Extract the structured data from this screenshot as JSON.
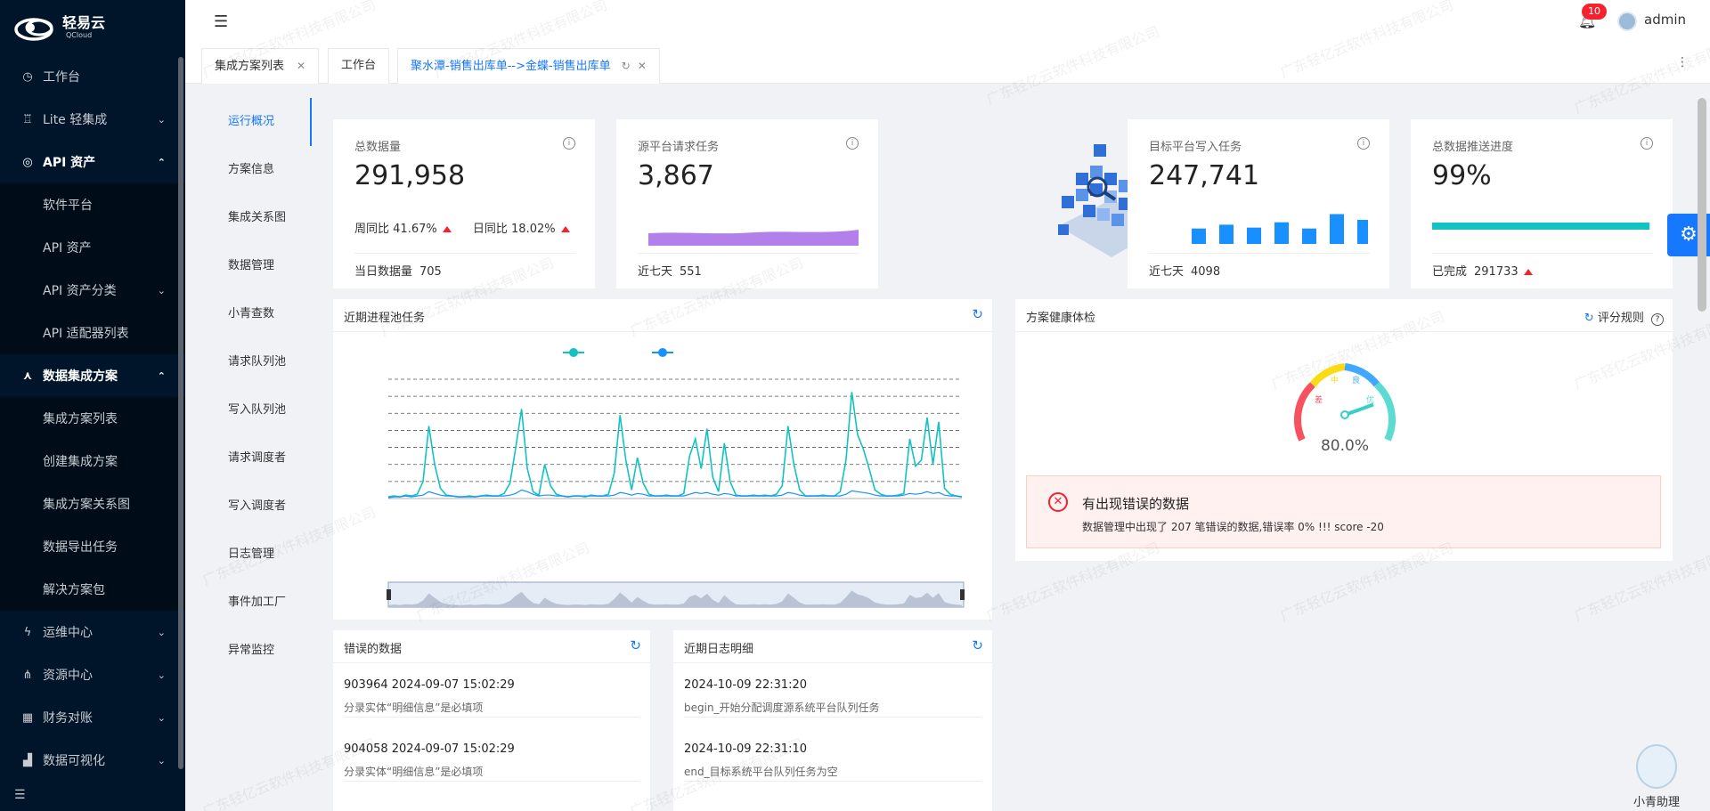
{
  "sidebar": {
    "logo_text": "轻易云",
    "logo_sub": "QCloud",
    "items": [
      {
        "label": "工作台",
        "icon": "clock-icon",
        "chevron": ""
      },
      {
        "label": "Lite 轻集成",
        "icon": "lite-icon",
        "chevron": "⌄"
      },
      {
        "label": "API 资产",
        "icon": "compass-icon",
        "chevron": "⌃"
      },
      {
        "label": "软件平台"
      },
      {
        "label": "API 资产"
      },
      {
        "label": "API 资产分类",
        "chevron": "⌄"
      },
      {
        "label": "API 适配器列表"
      },
      {
        "label": "数据集成方案",
        "icon": "cluster-icon",
        "chevron": "⌃"
      },
      {
        "label": "集成方案列表"
      },
      {
        "label": "创建集成方案"
      },
      {
        "label": "集成方案关系图"
      },
      {
        "label": "数据导出任务"
      },
      {
        "label": "解决方案包"
      },
      {
        "label": "运维中心",
        "icon": "bolt-icon",
        "chevron": "⌄"
      },
      {
        "label": "资源中心",
        "icon": "share-icon",
        "chevron": "⌄"
      },
      {
        "label": "财务对账",
        "icon": "calc-icon",
        "chevron": "⌄"
      },
      {
        "label": "数据可视化",
        "icon": "barchart-icon",
        "chevron": "⌄"
      }
    ]
  },
  "header": {
    "notification_count": "10",
    "username": "admin"
  },
  "tabs": [
    {
      "label": "集成方案列表"
    },
    {
      "label": "工作台"
    },
    {
      "label": "聚水潭-销售出库单-->金蝶-销售出库单"
    }
  ],
  "subnav": [
    "运行概况",
    "方案信息",
    "集成关系图",
    "数据管理",
    "小青查数",
    "请求队列池",
    "写入队列池",
    "请求调度者",
    "写入调度者",
    "日志管理",
    "事件加工厂",
    "异常监控"
  ],
  "stats": {
    "total": {
      "title": "总数据量",
      "value": "291,958",
      "wow_label": "周同比",
      "wow_value": "41.67%",
      "dod_label": "日同比",
      "dod_value": "18.02%",
      "foot_label": "当日数据量",
      "foot_value": "705"
    },
    "source": {
      "title": "源平台请求任务",
      "value": "3,867",
      "foot_label": "近七天",
      "foot_value": "551"
    },
    "target": {
      "title": "目标平台写入任务",
      "value": "247,741",
      "foot_label": "近七天",
      "foot_value": "4098",
      "bars": [
        0.32,
        0.4,
        0.34,
        0.45,
        0.32,
        0.62,
        0.5
      ]
    },
    "progress": {
      "title": "总数据推送进度",
      "value": "99%",
      "percent": 99,
      "foot_label": "已完成",
      "foot_value": "291733"
    }
  },
  "panels": {
    "recent_pool": {
      "title": "近期进程池任务"
    },
    "health": {
      "title": "方案健康体检",
      "rule_label": "评分规则",
      "score_text": "80.0%",
      "score": 80,
      "gauge_labels": {
        "poor": "差",
        "mid": "中",
        "good": "良",
        "excellent": "优"
      }
    },
    "errors": {
      "title": "错误的数据"
    },
    "logs": {
      "title": "近期日志明细"
    }
  },
  "alert": {
    "title": "有出现错误的数据",
    "desc": "数据管理中出现了 207 笔错误的数据,错误率 0% !!! score -20"
  },
  "error_items": [
    {
      "line1": "903964 2024-09-07 15:02:29",
      "line2": "分录实体“明细信息”是必填项"
    },
    {
      "line1": "904058 2024-09-07 15:02:29",
      "line2": "分录实体“明细信息”是必填项"
    }
  ],
  "log_items": [
    {
      "line1": "2024-10-09 22:31:20",
      "line2": "begin_开始分配调度源系统平台队列任务"
    },
    {
      "line1": "2024-10-09 22:31:10",
      "line2": "end_目标系统平台队列任务为空"
    }
  ],
  "assistant": {
    "label": "小青助理"
  },
  "watermark": "广东轻亿云软件科技有限公司",
  "colors": {
    "primary": "#1677ff",
    "sidebar_bg": "#001529",
    "teal": "#13c2c2",
    "danger": "#f5222d",
    "purple": "#b37feb"
  },
  "chart_data": {
    "type": "line",
    "title": "",
    "x_count": 100,
    "ylim": [
      0,
      140
    ],
    "series": [
      {
        "color": "#13c2c2",
        "values": [
          2,
          3,
          2,
          4,
          3,
          5,
          20,
          85,
          40,
          12,
          4,
          3,
          2,
          2,
          3,
          2,
          3,
          4,
          3,
          3,
          6,
          18,
          60,
          105,
          35,
          8,
          4,
          40,
          15,
          5,
          3,
          2,
          3,
          3,
          2,
          4,
          3,
          3,
          5,
          30,
          98,
          45,
          10,
          48,
          18,
          5,
          3,
          3,
          4,
          3,
          3,
          6,
          50,
          70,
          35,
          82,
          25,
          8,
          65,
          20,
          4,
          3,
          3,
          4,
          3,
          4,
          3,
          5,
          15,
          85,
          40,
          10,
          3,
          3,
          3,
          4,
          3,
          3,
          8,
          45,
          125,
          75,
          58,
          35,
          10,
          5,
          3,
          3,
          4,
          6,
          70,
          38,
          45,
          95,
          40,
          90,
          12,
          5,
          3,
          2
        ]
      },
      {
        "color": "#1890ff",
        "values": [
          1,
          2,
          2,
          3,
          2,
          3,
          4,
          8,
          6,
          4,
          3,
          3,
          2,
          2,
          2,
          2,
          3,
          3,
          3,
          3,
          3,
          4,
          6,
          10,
          8,
          5,
          3,
          4,
          4,
          3,
          3,
          2,
          3,
          3,
          3,
          3,
          3,
          3,
          3,
          4,
          7,
          6,
          4,
          6,
          5,
          3,
          3,
          3,
          3,
          3,
          3,
          3,
          5,
          7,
          6,
          7,
          5,
          4,
          6,
          5,
          3,
          3,
          3,
          3,
          3,
          3,
          3,
          3,
          4,
          7,
          6,
          4,
          3,
          3,
          3,
          3,
          3,
          3,
          3,
          5,
          9,
          8,
          7,
          6,
          4,
          3,
          3,
          3,
          3,
          4,
          6,
          5,
          6,
          8,
          6,
          7,
          4,
          3,
          3,
          2
        ]
      }
    ]
  }
}
